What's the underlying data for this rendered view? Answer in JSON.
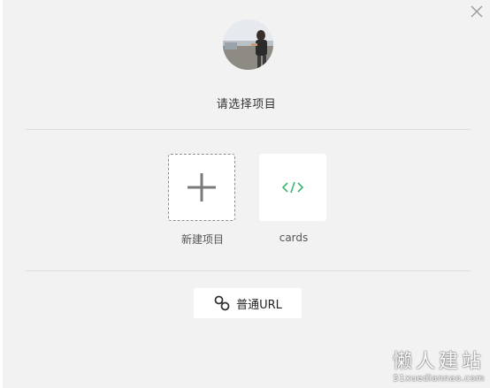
{
  "dialog": {
    "close_icon": "close-icon",
    "prompt": "请选择项目"
  },
  "projects": [
    {
      "label": "新建项目",
      "icon": "plus-icon"
    },
    {
      "label": "cards",
      "icon": "code-icon",
      "icon_color": "#3cb371"
    }
  ],
  "url_button": {
    "label": "普通URL",
    "icon": "link-icon"
  },
  "watermark": {
    "title": "懒人建站",
    "subtitle": "51xuediannao.com"
  }
}
